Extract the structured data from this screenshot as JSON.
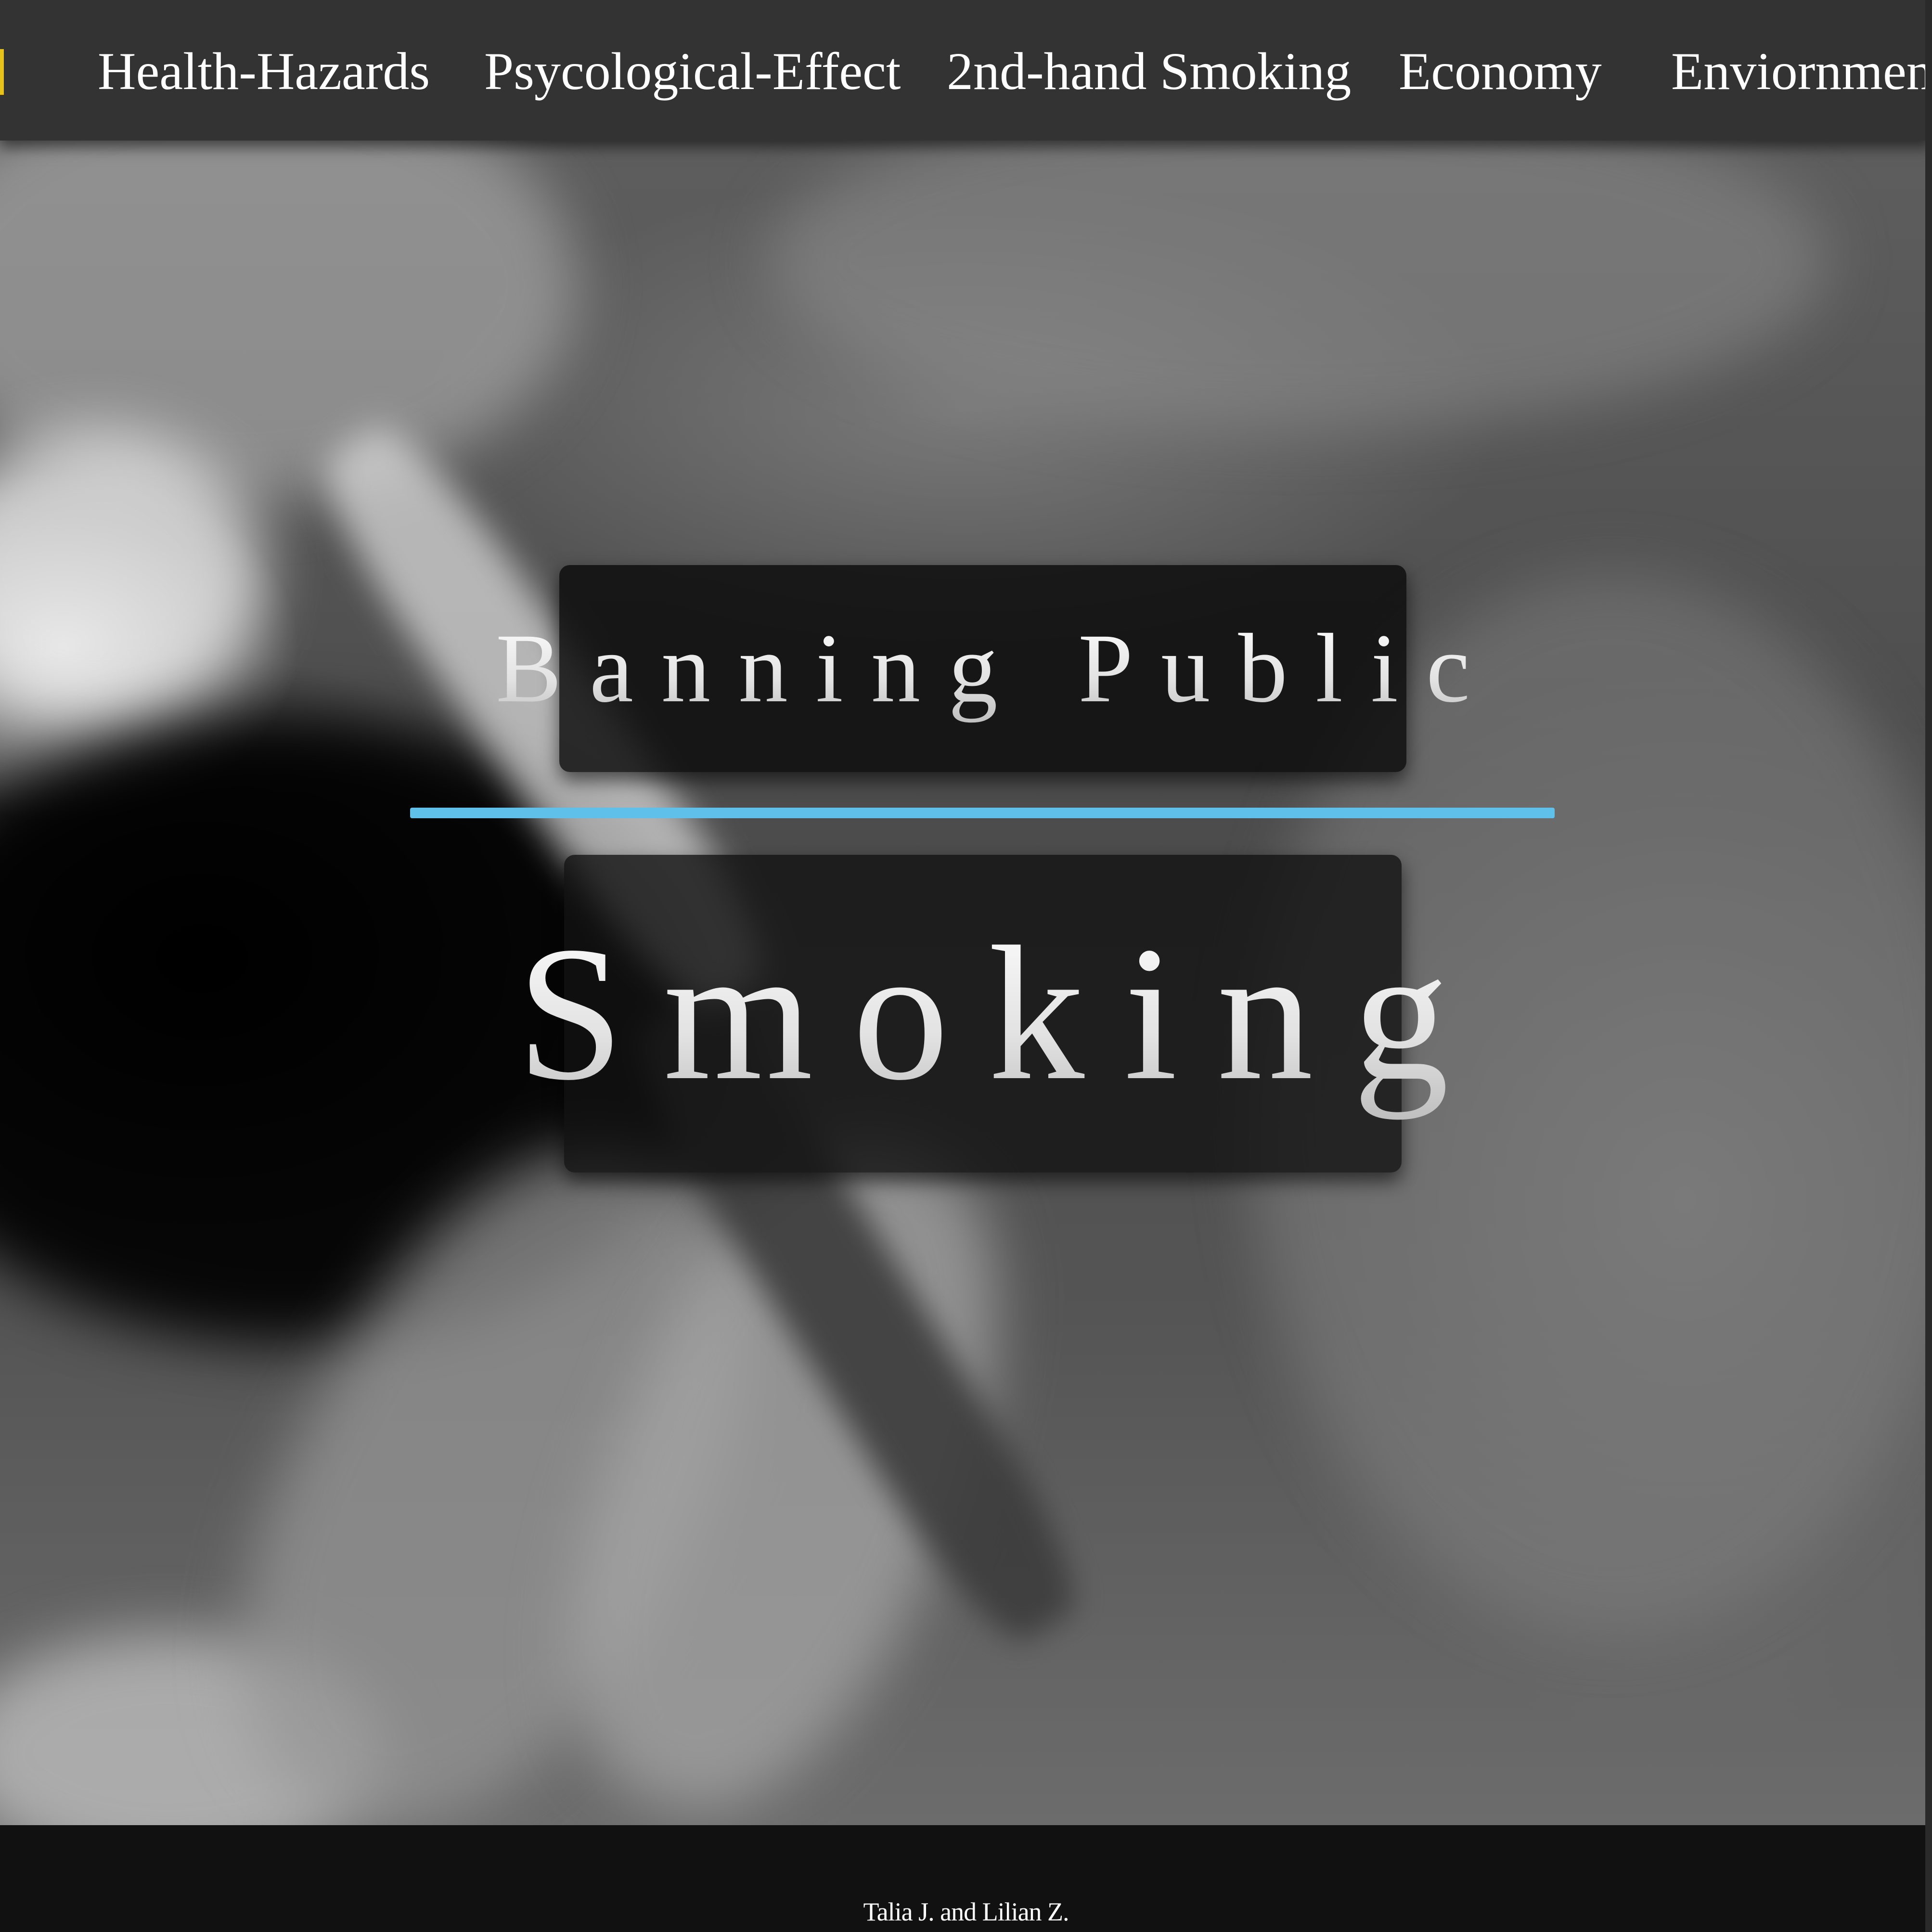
{
  "nav": {
    "items": [
      {
        "label": "Health-Hazards"
      },
      {
        "label": "Psycological-Effect"
      },
      {
        "label": "2nd-hand Smoking"
      },
      {
        "label": "Economy"
      },
      {
        "label": "Enviornment"
      }
    ]
  },
  "hero": {
    "title_line1": "Banning Public",
    "title_line2": "Smoking",
    "divider_color": "#5fc1ea"
  },
  "footer": {
    "credit": "Talia J. and Lilian Z."
  },
  "colors": {
    "nav_background": "#333333",
    "nav_marker": "#e6c21a",
    "footer_background": "#111111"
  }
}
